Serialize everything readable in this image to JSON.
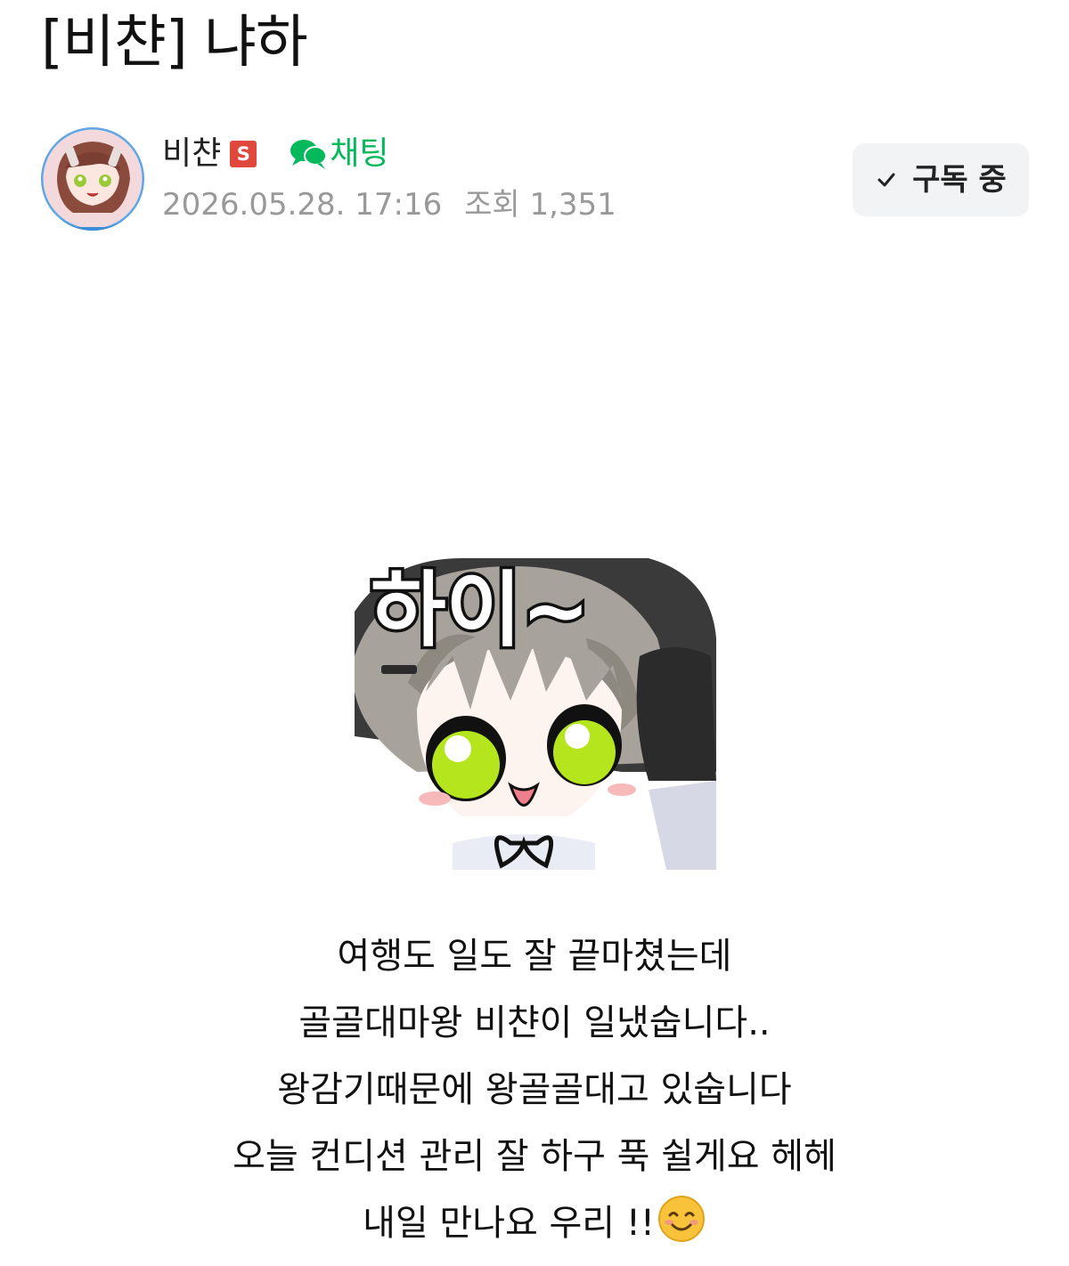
{
  "post": {
    "title": "[비챤] 냐하",
    "author": "비챤",
    "author_badge": "S",
    "chat_label": "채팅",
    "date": "2026.05.28. 17:16",
    "views_label": "조회 1,351",
    "subscribe_label": "구독 중",
    "sticker_text": "하이~",
    "body_lines": [
      "여행도 일도 잘 끝마쳤는데",
      "골골대마왕 비챤이 일냈숩니다..",
      "왕감기때문에 왕골골대고 있숩니다",
      "오늘 컨디션 관리 잘 하구 푹 쉴게요 헤헤",
      "내일 만나요 우리 !!"
    ]
  },
  "colors": {
    "chat_green": "#03b95b",
    "staff_badge_red": "#e0483c",
    "meta_gray": "#999999",
    "subscribe_bg": "#f2f3f5",
    "sticker_eye_green": "#b5e61d"
  },
  "icons": {
    "chat": "speech-bubbles-icon",
    "subscribe": "check-icon",
    "emoji": "smiling-face-emoji"
  }
}
